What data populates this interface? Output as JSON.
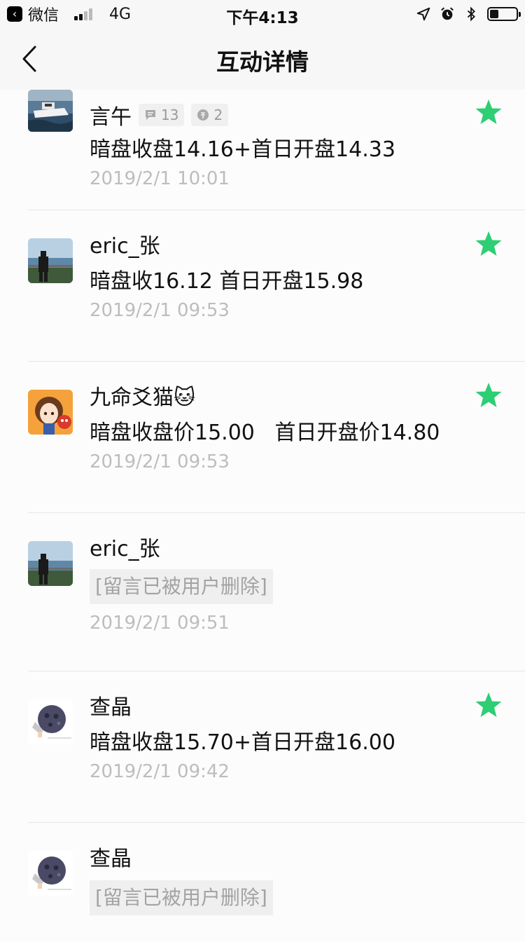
{
  "status_bar": {
    "back_app_label": "微信",
    "network": "4G",
    "time": "下午4:13"
  },
  "nav": {
    "title": "互动详情"
  },
  "colors": {
    "accent_green": "#2dce74"
  },
  "comments": [
    {
      "name": "言午",
      "avatar": "boat-photo",
      "comment_count": "13",
      "coin_count": "2",
      "content": "暗盘收盘14.16+首日开盘14.33",
      "deleted": false,
      "time": "2019/2/1 10:01",
      "starred": true
    },
    {
      "name": "eric_张",
      "avatar": "seaside-person-photo",
      "content": "暗盘收16.12 首日开盘15.98",
      "deleted": false,
      "time": "2019/2/1 09:53",
      "starred": true
    },
    {
      "name": "九命爻猫🐱",
      "avatar": "anime-girl",
      "content": "暗盘收盘价15.00   首日开盘价14.80",
      "deleted": false,
      "time": "2019/2/1 09:53",
      "starred": true
    },
    {
      "name": "eric_张",
      "avatar": "seaside-person-photo",
      "content": "[留言已被用户删除]",
      "deleted": true,
      "time": "2019/2/1 09:51",
      "starred": false
    },
    {
      "name": "查晶",
      "avatar": "moon-face",
      "content": "暗盘收盘15.70+首日开盘16.00",
      "deleted": false,
      "time": "2019/2/1 09:42",
      "starred": true
    },
    {
      "name": "查晶",
      "avatar": "moon-face",
      "content": "[留言已被用户删除]",
      "deleted": true,
      "time": "",
      "starred": false
    }
  ]
}
